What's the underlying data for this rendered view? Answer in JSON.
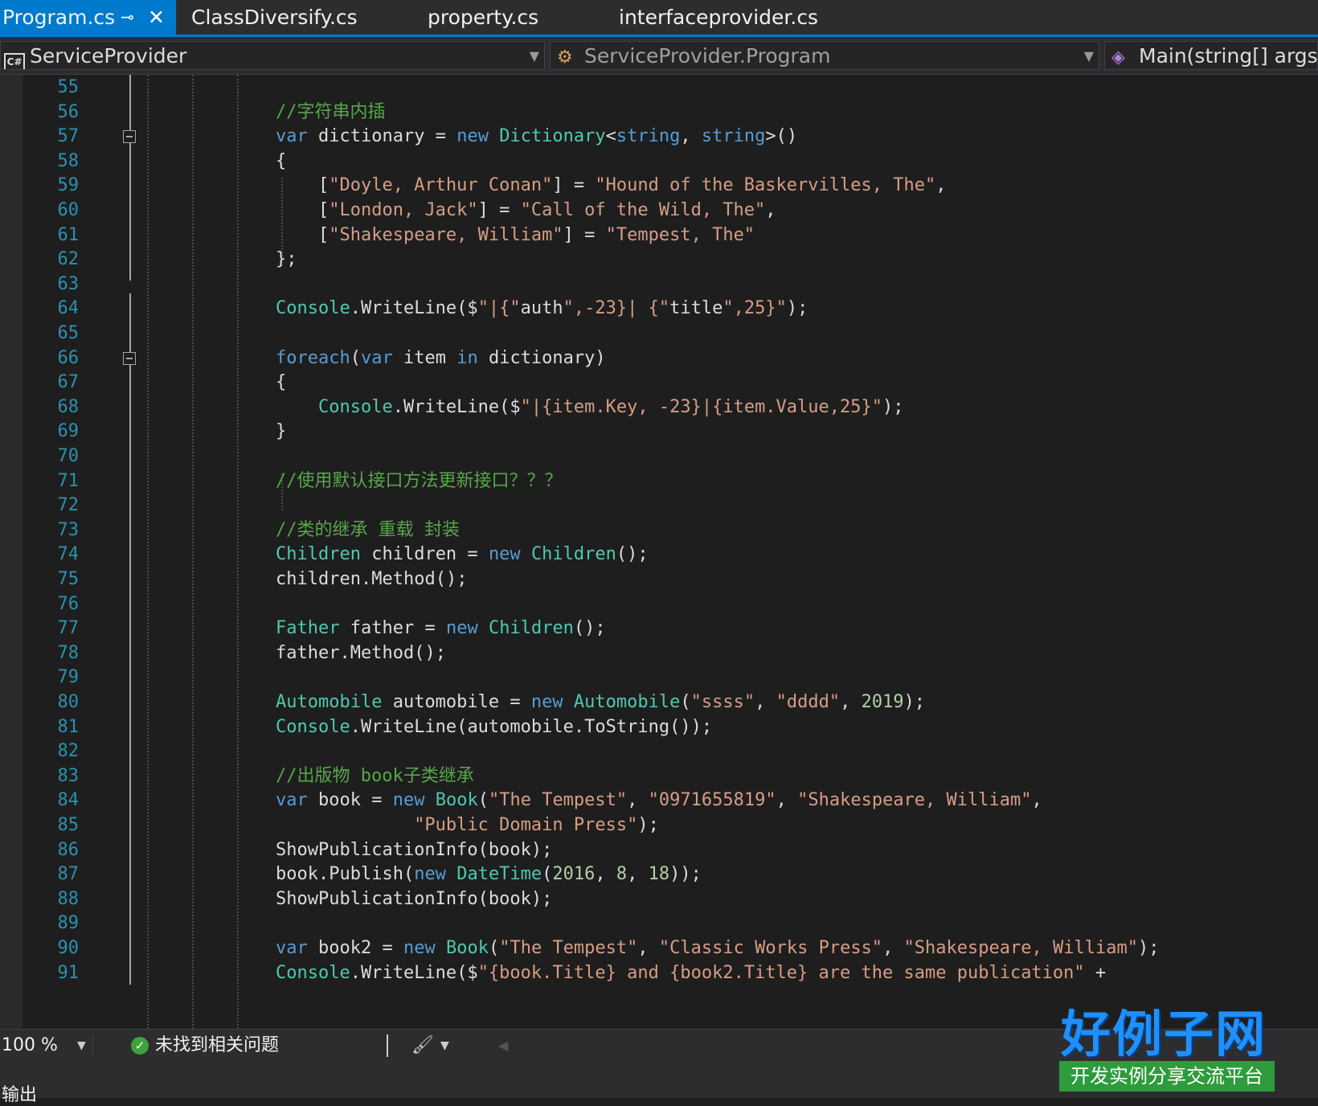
{
  "tabs": [
    {
      "label": "Program.cs",
      "active": true,
      "pin_icon": "pin-icon",
      "close_icon": "close-icon"
    },
    {
      "label": "ClassDiversify.cs",
      "active": false
    },
    {
      "label": "property.cs",
      "active": false
    },
    {
      "label": "interfaceprovider.cs",
      "active": false
    }
  ],
  "navbar": {
    "project": "ServiceProvider",
    "class": "ServiceProvider.Program",
    "member": "Main(string[] args)"
  },
  "editor": {
    "lines": [
      {
        "number": "55",
        "code": ""
      },
      {
        "number": "56",
        "code": "//字符串内插"
      },
      {
        "number": "57",
        "code": "var dictionary = new Dictionary<string, string>()"
      },
      {
        "number": "58",
        "code": "{"
      },
      {
        "number": "59",
        "code": "    [\"Doyle, Arthur Conan\"] = \"Hound of the Baskervilles, The\","
      },
      {
        "number": "60",
        "code": "    [\"London, Jack\"] = \"Call of the Wild, The\","
      },
      {
        "number": "61",
        "code": "    [\"Shakespeare, William\"] = \"Tempest, The\""
      },
      {
        "number": "62",
        "code": "};"
      },
      {
        "number": "63",
        "code": ""
      },
      {
        "number": "64",
        "code": "Console.WriteLine($\"|{\"auth\",-23}| {\"title\",25}\");"
      },
      {
        "number": "65",
        "code": ""
      },
      {
        "number": "66",
        "code": "foreach(var item in dictionary)"
      },
      {
        "number": "67",
        "code": "{"
      },
      {
        "number": "68",
        "code": "    Console.WriteLine($\"|{item.Key, -23}|{item.Value,25}\");"
      },
      {
        "number": "69",
        "code": "}"
      },
      {
        "number": "70",
        "code": ""
      },
      {
        "number": "71",
        "code": "//使用默认接口方法更新接口？？？"
      },
      {
        "number": "72",
        "code": ""
      },
      {
        "number": "73",
        "code": "//类的继承 重载 封装"
      },
      {
        "number": "74",
        "code": "Children children = new Children();"
      },
      {
        "number": "75",
        "code": "children.Method();"
      },
      {
        "number": "76",
        "code": ""
      },
      {
        "number": "77",
        "code": "Father father = new Children();"
      },
      {
        "number": "78",
        "code": "father.Method();"
      },
      {
        "number": "79",
        "code": ""
      },
      {
        "number": "80",
        "code": "Automobile automobile = new Automobile(\"ssss\", \"dddd\", 2019);"
      },
      {
        "number": "81",
        "code": "Console.WriteLine(automobile.ToString());"
      },
      {
        "number": "82",
        "code": ""
      },
      {
        "number": "83",
        "code": "//出版物 book子类继承"
      },
      {
        "number": "84",
        "code": "var book = new Book(\"The Tempest\", \"0971655819\", \"Shakespeare, William\","
      },
      {
        "number": "85",
        "code": "             \"Public Domain Press\");"
      },
      {
        "number": "86",
        "code": "ShowPublicationInfo(book);"
      },
      {
        "number": "87",
        "code": "book.Publish(new DateTime(2016, 8, 18));"
      },
      {
        "number": "88",
        "code": "ShowPublicationInfo(book);"
      },
      {
        "number": "89",
        "code": ""
      },
      {
        "number": "90",
        "code": "var book2 = new Book(\"The Tempest\", \"Classic Works Press\", \"Shakespeare, William\");"
      },
      {
        "number": "91",
        "code": "Console.WriteLine($\"{book.Title} and {book2.Title} are the same publication\" +"
      }
    ]
  },
  "statusbar": {
    "zoom": "100 %",
    "issues": "未找到相关问题"
  },
  "output_panel": {
    "label": "输出"
  },
  "watermark": {
    "logo": "好例子网",
    "banner": "开发实例分享交流平台"
  },
  "colors": {
    "accent": "#007acc",
    "editor_bg": "#1e1e1e",
    "keyword": "#569cd6",
    "type": "#4ec9b0",
    "string": "#d69d85",
    "comment": "#57a64a",
    "number": "#b5cea8",
    "line_number": "#2b91af"
  }
}
